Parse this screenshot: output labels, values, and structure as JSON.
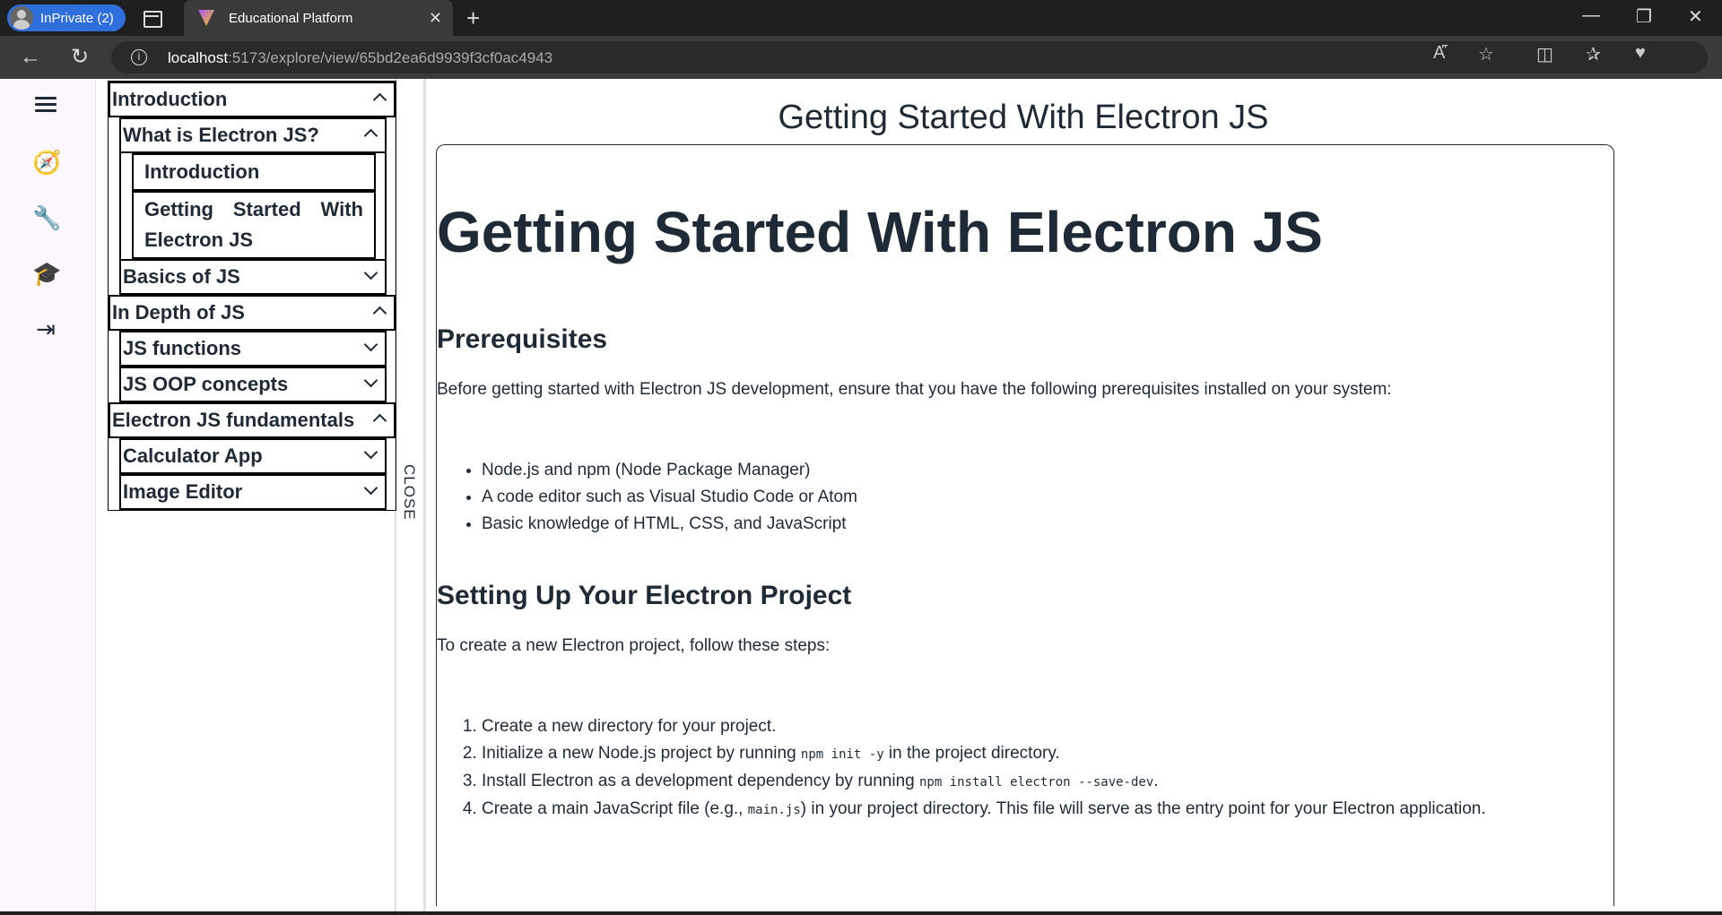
{
  "browser": {
    "profile_label": "InPrivate (2)",
    "tab_title": "Educational Platform",
    "url_host": "localhost",
    "url_rest": ":5173/explore/view/65bd2ea6d9939f3cf0ac4943"
  },
  "rail": {
    "icons": [
      "menu-icon",
      "compass-icon",
      "wrench-icon",
      "graduation-cap-icon",
      "logout-icon"
    ]
  },
  "sidebar": {
    "close_label": "CLOSE",
    "sections": [
      {
        "label": "Introduction",
        "children": [
          {
            "label": "What is Electron JS?",
            "leaves": [
              "Introduction",
              "Getting Started With Electron JS"
            ]
          },
          {
            "label": "Basics of JS"
          }
        ]
      },
      {
        "label": "In Depth of JS",
        "children": [
          {
            "label": "JS functions"
          },
          {
            "label": "JS OOP concepts"
          }
        ]
      },
      {
        "label": "Electron JS fundamentals",
        "children": [
          {
            "label": "Calculator App"
          },
          {
            "label": "Image Editor"
          }
        ]
      }
    ]
  },
  "main": {
    "page_title": "Getting Started With Electron JS",
    "heading": "Getting Started With Electron JS",
    "prereq_heading": "Prerequisites",
    "prereq_intro": "Before getting started with Electron JS development, ensure that you have the following prerequisites installed on your system:",
    "prereq_items": [
      "Node.js and npm (Node Package Manager)",
      "A code editor such as Visual Studio Code or Atom",
      "Basic knowledge of HTML, CSS, and JavaScript"
    ],
    "setup_heading": "Setting Up Your Electron Project",
    "setup_intro": "To create a new Electron project, follow these steps:",
    "steps": {
      "s1": "Create a new directory for your project.",
      "s2_pre": "Initialize a new Node.js project by running ",
      "s2_code": "npm init -y",
      "s2_post": " in the project directory.",
      "s3_pre": "Install Electron as a development dependency by running ",
      "s3_code": "npm install electron --save-dev",
      "s3_post": ".",
      "s4_pre": "Create a main JavaScript file (e.g., ",
      "s4_code": "main.js",
      "s4_post": ") in your project directory. This file will serve as the entry point for your Electron application."
    }
  }
}
